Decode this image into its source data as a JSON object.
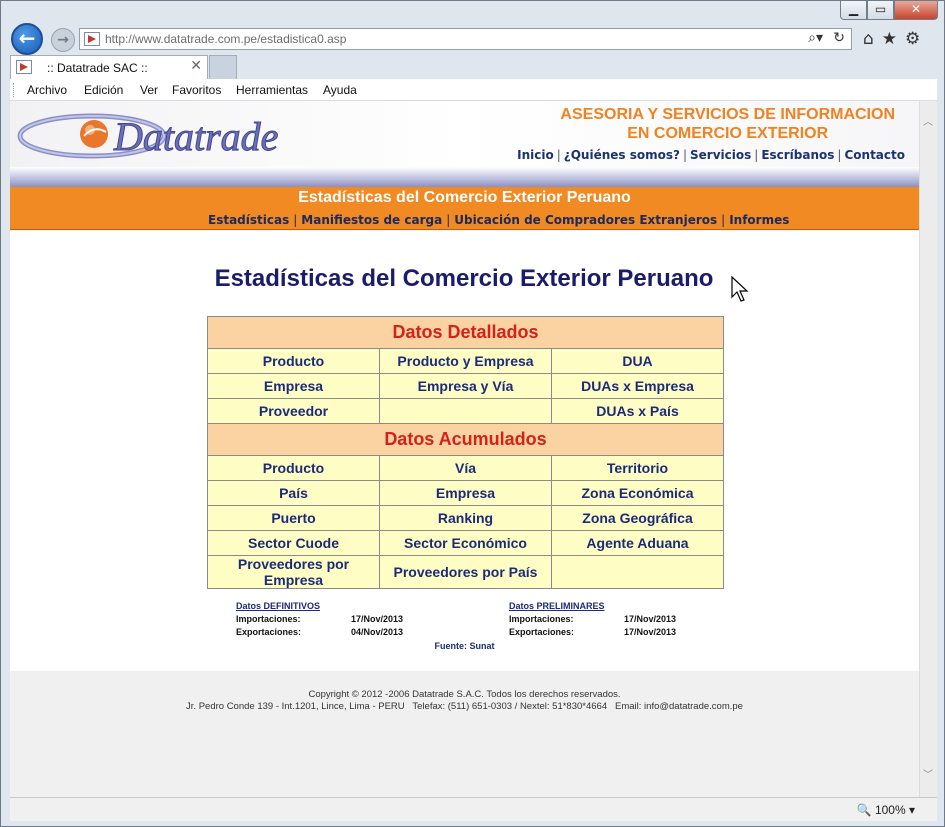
{
  "browser": {
    "window_buttons": {
      "minimize": "▁",
      "maximize": "▭",
      "close": "✕"
    },
    "url": "http://www.datatrade.com.pe/estadistica0.asp",
    "tab_title": ":: Datatrade SAC ::",
    "menu": [
      "Archivo",
      "Edición",
      "Ver",
      "Favoritos",
      "Herramientas",
      "Ayuda"
    ],
    "zoom": "100%",
    "icons": [
      "back-icon",
      "forward-icon",
      "search-icon",
      "refresh-icon",
      "home-icon",
      "favorites-star-icon",
      "gear-icon"
    ]
  },
  "site": {
    "logo_text": "Datatrade",
    "tagline_line1": "ASESORIA Y SERVICIOS DE INFORMACION",
    "tagline_line2": "EN COMERCIO EXTERIOR",
    "top_nav": [
      "Inicio",
      "¿Quiénes somos?",
      "Servicios",
      "Escríbanos",
      "Contacto"
    ],
    "banner_title": "Estadísticas del Comercio Exterior Peruano",
    "sub_nav": [
      "Estadísticas",
      "Manifiestos de carga",
      "Ubicación de Compradores Extranjeros",
      "Informes"
    ],
    "colors": {
      "accent_orange": "#f28a24",
      "navy": "#1b2a7a",
      "header_red": "#d4221b",
      "cell_bg": "#fefec4"
    }
  },
  "main": {
    "heading": "Estadísticas del Comercio Exterior Peruano",
    "detallados": {
      "title": "Datos Detallados",
      "rows": [
        [
          "Producto",
          "Producto y Empresa",
          "DUA"
        ],
        [
          "Empresa",
          "Empresa y Vía",
          "DUAs x Empresa"
        ],
        [
          "Proveedor",
          "",
          "DUAs x País"
        ]
      ]
    },
    "acumulados": {
      "title": "Datos Acumulados",
      "rows": [
        [
          "Producto",
          "Vía",
          "Territorio"
        ],
        [
          "País",
          "Empresa",
          "Zona Económica"
        ],
        [
          "Puerto",
          "Ranking",
          "Zona Geográfica"
        ],
        [
          "Sector Cuode",
          "Sector Económico",
          "Agente Aduana"
        ],
        [
          "Proveedores por Empresa",
          "Proveedores por País",
          ""
        ]
      ]
    },
    "definitivos": {
      "title": "Datos DEFINITIVOS",
      "import_label": "Importaciones:",
      "import_date": "17/Nov/2013",
      "export_label": "Exportaciones:",
      "export_date": "04/Nov/2013"
    },
    "preliminares": {
      "title": "Datos PRELIMINARES",
      "import_label": "Importaciones:",
      "import_date": "17/Nov/2013",
      "export_label": "Exportaciones:",
      "export_date": "17/Nov/2013"
    },
    "fuente": "Fuente: Sunat"
  },
  "footer": {
    "copyright": "Copyright © 2012 -2006 Datatrade S.A.C. Todos los derechos reservados.",
    "address": "Jr. Pedro Conde 139 - Int.1201, Lince, Lima - PERU   Telefax: (511) 651-0303 / Nextel: 51*830*4664   Email: info@datatrade.com.pe"
  }
}
